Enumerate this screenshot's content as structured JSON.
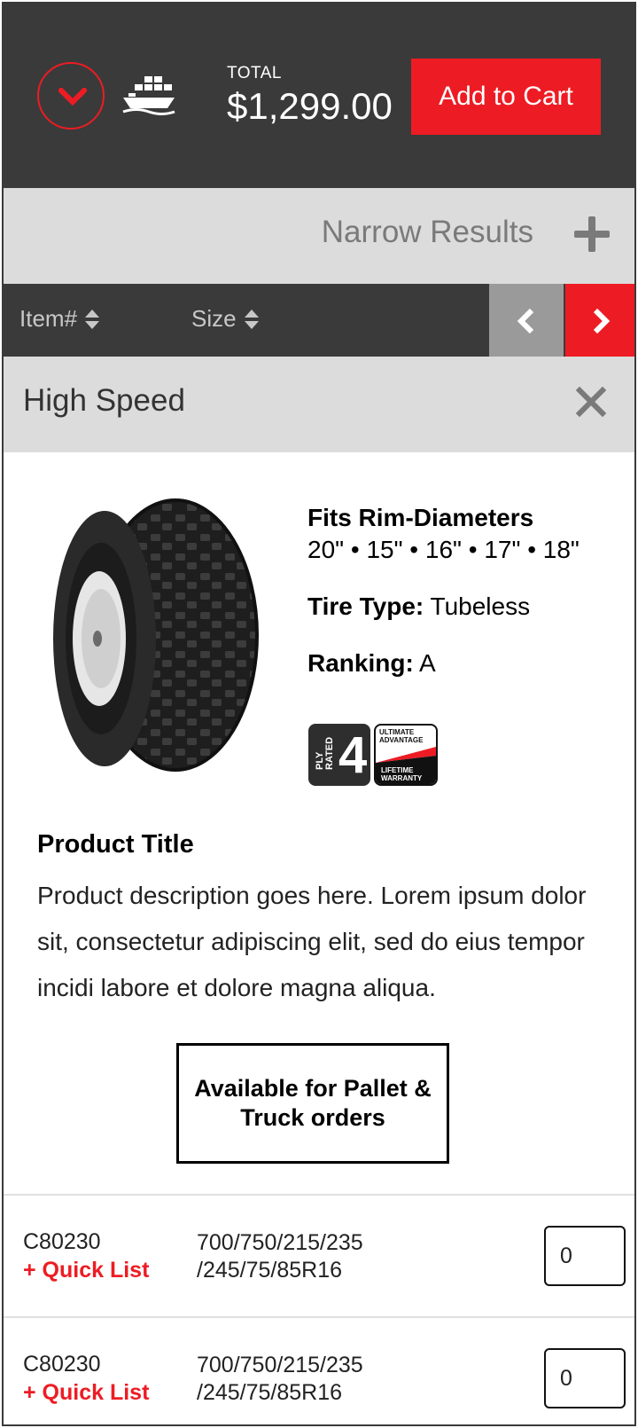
{
  "header": {
    "total_label": "TOTAL",
    "total_amount": "$1,299.00",
    "add_to_cart_label": "Add to Cart",
    "collapse_icon": "chevron-down-icon",
    "shipping_icon": "ship-icon"
  },
  "filters": {
    "narrow_label": "Narrow Results",
    "narrow_icon": "plus-icon"
  },
  "sort": {
    "columns": [
      "Item#",
      "Size"
    ],
    "prev_icon": "chevron-left-icon",
    "next_icon": "chevron-right-icon"
  },
  "group": {
    "title": "High Speed",
    "close_icon": "close-icon"
  },
  "product": {
    "fits_label": "Fits Rim-Diameters",
    "fits_values": "20\" • 15\" • 16\" • 17\" • 18\"",
    "tire_type_label": "Tire Type:",
    "tire_type_value": "Tubeless",
    "ranking_label": "Ranking:",
    "ranking_value": "A",
    "ply_badge_text": "PLY RATED",
    "ply_badge_number": "4",
    "warranty_badge_top": "ULTIMATE ADVANTAGE",
    "warranty_badge_bottom": "LIFETIME WARRANTY",
    "title": "Product Title",
    "description": "Product description goes here. Lorem ipsum dolor sit, consectetur adipiscing elit, sed do eius tempor incidi labore et dolore magna aliqua.",
    "availability": "Available for Pallet & Truck orders"
  },
  "rows": [
    {
      "item_num": "C80230",
      "quick_list": "+ Quick List",
      "size": "700/750/215/235\n/245/75/85R16",
      "qty": "0"
    },
    {
      "item_num": "C80230",
      "quick_list": "+ Quick List",
      "size": "700/750/215/235\n/245/75/85R16",
      "qty": "0"
    }
  ],
  "colors": {
    "accent": "#ed1c24",
    "dark": "#3a3a3a",
    "light_bar": "#dcdcdc",
    "muted": "#9a9a9a"
  }
}
